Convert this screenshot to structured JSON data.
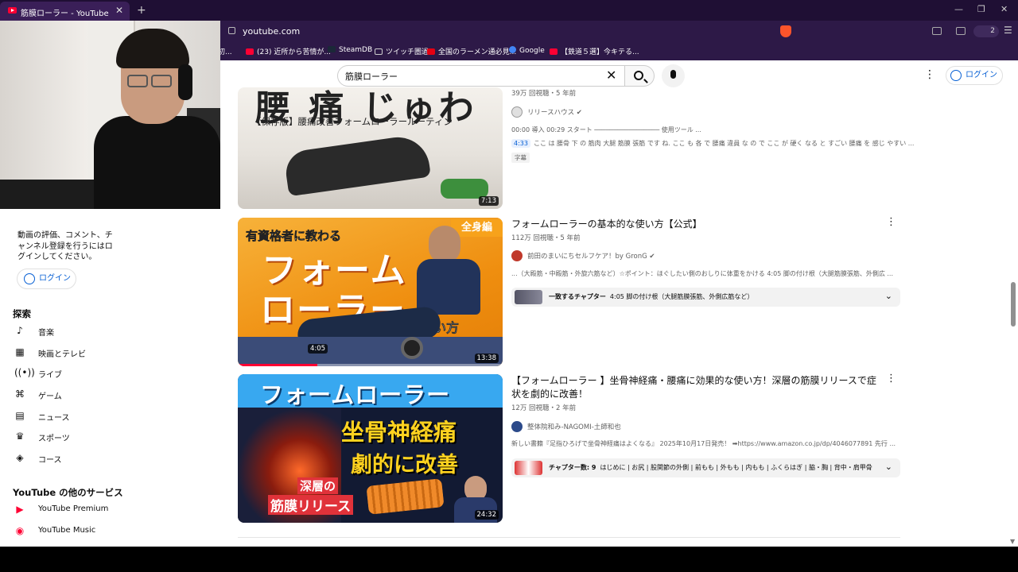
{
  "browser": {
    "tab_title": "筋膜ローラー - YouTube",
    "new_tab": "+",
    "tab_close": "✕",
    "url": "youtube.com",
    "ext_count": "2",
    "win_minimize": "—",
    "win_restore": "❐",
    "win_close": "✕",
    "bookmarks": [
      "初...",
      "(23) 近所から苦情が...",
      "SteamDB",
      "ツイッチ圏過",
      "全国のラーメン通必見...",
      "Google",
      "【鉄道５選】今キテる..."
    ]
  },
  "header": {
    "search_query": "筋膜ローラー",
    "clear_icon": "✕",
    "more_icon": "⋮",
    "login_label": "ログイン"
  },
  "sidebar": {
    "login_note": "動画の評価、コメント、チャンネル登録を行うにはログインしてください。",
    "login_label": "ログイン",
    "explore_heading": "探索",
    "explore_items": [
      "音楽",
      "映画とテレビ",
      "ライブ",
      "ゲーム",
      "ニュース",
      "スポーツ",
      "コース"
    ],
    "more_heading": "YouTube の他のサービス",
    "more_items": [
      "YouTube Premium",
      "YouTube Music"
    ]
  },
  "videos": [
    {
      "thumb_big_text": "腰 痛 じゅわ",
      "thumb_sub_text": "【保存版】腰痛改善フォームローラールーティン",
      "duration": "7:13",
      "meta": "39万 回視聴・5 年前",
      "channel": "リリースハウス",
      "desc_line1": "00:00 導入 00:29 スタート ───────────────── 使用ツール ...",
      "timestamp": "4:33",
      "desc_line2": "ここ は 腰骨 下 の 筋肉 大腿 筋膜 張筋 です ね. ここ も 各 で 腰痛 違員 な の で ここ が 硬く なる と すごい 腰痛 を 感じ やすい ...",
      "subtitle_badge": "字幕"
    },
    {
      "title": "フォームローラーの基本的な使い方【公式】",
      "thumb_tag": "全身編",
      "thumb_line1": "有資格者に教わる",
      "thumb_line2": "フォーム",
      "thumb_line3": "ローラー",
      "thumb_line4": "の基本的な使い方",
      "progress_time": "4:05",
      "duration": "13:38",
      "meta": "112万 回視聴・5 年前",
      "channel": "前田のまいにちセルフケア！by GronG",
      "desc": "...（大殿筋・中殿筋・外旋六筋など）☆ポイント：ほぐしたい側のおしりに体重をかける 4:05 脚の付け根（大腿筋膜張筋、外側広 ...",
      "chapter_label": "一致するチャプター",
      "chapter_text": "4:05 脚の付け根（大腿筋膜張筋、外側広筋など）"
    },
    {
      "title": "【フォームローラー 】坐骨神経痛・腰痛に効果的な使い方！深層の筋膜リリースで症状を劇的に改善！",
      "thumb_line1": "フォームローラー",
      "thumb_line2": "坐骨神経痛",
      "thumb_line3": "劇的に改善",
      "thumb_line4": "深層の",
      "thumb_line5": "筋膜リリース",
      "duration": "24:32",
      "meta": "12万 回視聴・2 年前",
      "channel": "整体院和み-NAGOMI-土師和也",
      "desc": "新しい書籍『足指ひろげで坐骨神経痛はよくなる』 2025年10月17日発売！ ➡https://www.amazon.co.jp/dp/4046077891 先行 ...",
      "chapter_label": "チャプター数: 9",
      "chapter_text": "はじめに | お尻 | 股関節の外側 | 前もも | 外もも | 内もも | ふくらはぎ | 脇・胸 | 背中・肩甲骨"
    }
  ],
  "colors": {
    "accent": "#065fd4",
    "youtube_red": "#ff0033",
    "browser_bg": "#2d1947"
  }
}
